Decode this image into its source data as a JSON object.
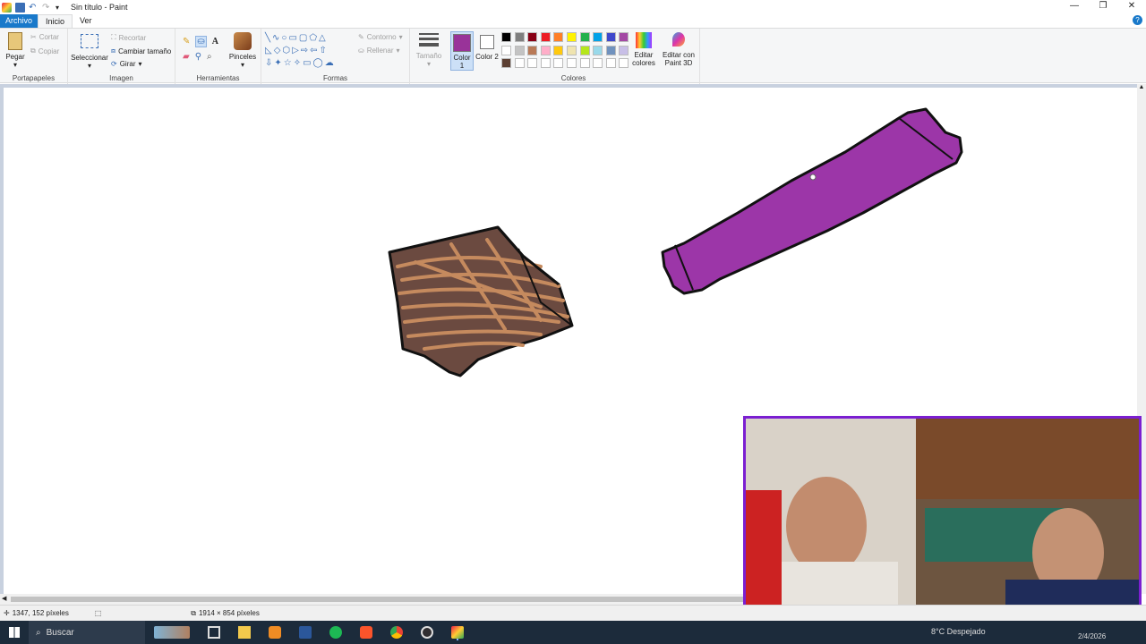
{
  "window": {
    "title": "Sin título - Paint",
    "controls": [
      "—",
      "❐",
      "✕"
    ]
  },
  "menu": {
    "file": "Archivo",
    "tabs": [
      "Inicio",
      "Ver"
    ]
  },
  "ribbon": {
    "clipboard": {
      "label": "Portapapeles",
      "paste": "Pegar",
      "cut": "Cortar",
      "copy": "Copiar"
    },
    "image": {
      "label": "Imagen",
      "select": "Seleccionar",
      "crop": "Recortar",
      "resize": "Cambiar tamaño",
      "rotate": "Girar"
    },
    "tools": {
      "label": "Herramientas",
      "brushes": "Pinceles"
    },
    "shapes": {
      "label": "Formas",
      "outline": "Contorno",
      "fill": "Rellenar"
    },
    "size": {
      "label": "Tamaño"
    },
    "colors": {
      "label": "Colores",
      "color1": "Color 1",
      "color2": "Color 2",
      "edit_colors": "Editar colores",
      "paint3d": "Editar con Paint 3D",
      "color1_value": "#993399",
      "color2_value": "#ffffff",
      "palette_row1": [
        "#000000",
        "#7f7f7f",
        "#880015",
        "#ed1c24",
        "#ff7f27",
        "#fff200",
        "#22b14c",
        "#00a2e8",
        "#3f48cc",
        "#a349a4"
      ],
      "palette_row2": [
        "#ffffff",
        "#c3c3c3",
        "#b97a57",
        "#ffaec9",
        "#ffc90e",
        "#efe4b0",
        "#b5e61d",
        "#99d9ea",
        "#7092be",
        "#c8bfe7"
      ],
      "palette_row3": [
        "#5c4033",
        "#ffffff",
        "#ffffff",
        "#ffffff",
        "#ffffff",
        "#ffffff",
        "#ffffff",
        "#ffffff",
        "#ffffff",
        "#ffffff"
      ]
    }
  },
  "status": {
    "cursor_pos": "1347, 152 píxeles",
    "canvas_size": "1914 × 854 píxeles"
  },
  "taskbar": {
    "search": "Buscar",
    "weather": "8°C  Despejado",
    "date": "2/4/2026"
  }
}
